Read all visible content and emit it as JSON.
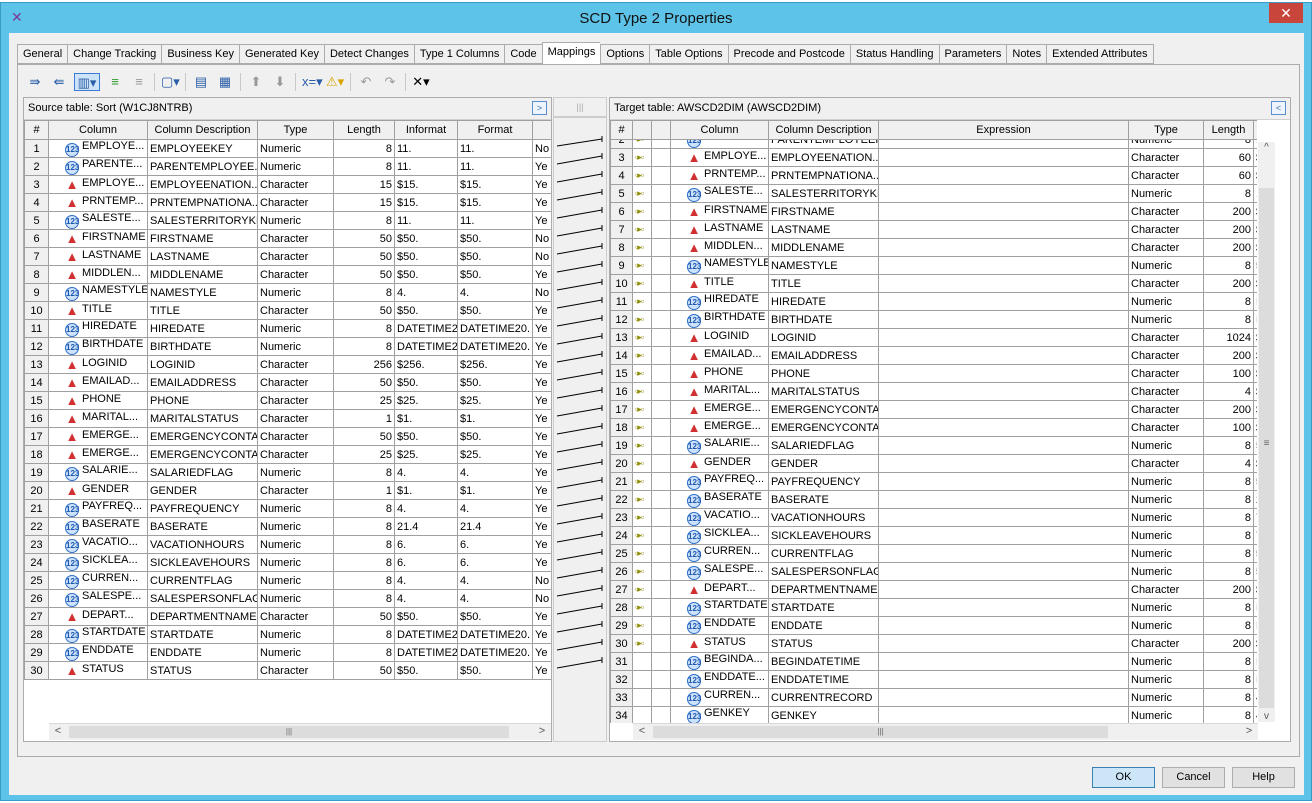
{
  "window": {
    "title": "SCD Type 2 Properties",
    "close_icon": "close-icon",
    "app_icon": "scd-transform-icon"
  },
  "tabs": [
    "General",
    "Change Tracking",
    "Business Key",
    "Generated Key",
    "Detect Changes",
    "Type 1 Columns",
    "Code",
    "Mappings",
    "Options",
    "Table Options",
    "Precode and Postcode",
    "Status Handling",
    "Parameters",
    "Notes",
    "Extended Attributes"
  ],
  "active_tab": "Mappings",
  "toolbar": [
    "map-source-icon",
    "map-target-icon",
    "map-all-dropdown-icon",
    "map-columns-icon",
    "unmap-columns-icon",
    "new-column-dropdown-icon",
    "import-columns-icon",
    "propagate-icon",
    "move-up-icon",
    "move-down-icon",
    "expression-dropdown-icon",
    "warning-dropdown-icon",
    "undo-icon",
    "redo-icon",
    "delete-dropdown-icon"
  ],
  "source": {
    "title": "Source table: Sort (W1CJ8NTRB)",
    "headers": [
      "#",
      "Column",
      "Column Description",
      "Type",
      "Length",
      "Informat",
      "Format",
      ""
    ],
    "rows": [
      [
        "1",
        "EMPLOYE...",
        "EMPLOYEEKEY",
        "Numeric",
        "8",
        "11.",
        "11.",
        "No"
      ],
      [
        "2",
        "PARENTE...",
        "PARENTEMPLOYEE...",
        "Numeric",
        "8",
        "11.",
        "11.",
        "Ye"
      ],
      [
        "3",
        "EMPLOYE...",
        "EMPLOYEENATION...",
        "Character",
        "15",
        "$15.",
        "$15.",
        "Ye"
      ],
      [
        "4",
        "PRNTEMP...",
        "PRNTEMPNATIONA...",
        "Character",
        "15",
        "$15.",
        "$15.",
        "Ye"
      ],
      [
        "5",
        "SALESTE...",
        "SALESTERRITORYKEY",
        "Numeric",
        "8",
        "11.",
        "11.",
        "Ye"
      ],
      [
        "6",
        "FIRSTNAME",
        "FIRSTNAME",
        "Character",
        "50",
        "$50.",
        "$50.",
        "No"
      ],
      [
        "7",
        "LASTNAME",
        "LASTNAME",
        "Character",
        "50",
        "$50.",
        "$50.",
        "No"
      ],
      [
        "8",
        "MIDDLEN...",
        "MIDDLENAME",
        "Character",
        "50",
        "$50.",
        "$50.",
        "Ye"
      ],
      [
        "9",
        "NAMESTYLE",
        "NAMESTYLE",
        "Numeric",
        "8",
        "4.",
        "4.",
        "No"
      ],
      [
        "10",
        "TITLE",
        "TITLE",
        "Character",
        "50",
        "$50.",
        "$50.",
        "Ye"
      ],
      [
        "11",
        "HIREDATE",
        "HIREDATE",
        "Numeric",
        "8",
        "DATETIME20.",
        "DATETIME20.",
        "Ye"
      ],
      [
        "12",
        "BIRTHDATE",
        "BIRTHDATE",
        "Numeric",
        "8",
        "DATETIME20.",
        "DATETIME20.",
        "Ye"
      ],
      [
        "13",
        "LOGINID",
        "LOGINID",
        "Character",
        "256",
        "$256.",
        "$256.",
        "Ye"
      ],
      [
        "14",
        "EMAILAD...",
        "EMAILADDRESS",
        "Character",
        "50",
        "$50.",
        "$50.",
        "Ye"
      ],
      [
        "15",
        "PHONE",
        "PHONE",
        "Character",
        "25",
        "$25.",
        "$25.",
        "Ye"
      ],
      [
        "16",
        "MARITAL...",
        "MARITALSTATUS",
        "Character",
        "1",
        "$1.",
        "$1.",
        "Ye"
      ],
      [
        "17",
        "EMERGE...",
        "EMERGENCYCONTA...",
        "Character",
        "50",
        "$50.",
        "$50.",
        "Ye"
      ],
      [
        "18",
        "EMERGE...",
        "EMERGENCYCONTA...",
        "Character",
        "25",
        "$25.",
        "$25.",
        "Ye"
      ],
      [
        "19",
        "SALARIE...",
        "SALARIEDFLAG",
        "Numeric",
        "8",
        "4.",
        "4.",
        "Ye"
      ],
      [
        "20",
        "GENDER",
        "GENDER",
        "Character",
        "1",
        "$1.",
        "$1.",
        "Ye"
      ],
      [
        "21",
        "PAYFREQ...",
        "PAYFREQUENCY",
        "Numeric",
        "8",
        "4.",
        "4.",
        "Ye"
      ],
      [
        "22",
        "BASERATE",
        "BASERATE",
        "Numeric",
        "8",
        "21.4",
        "21.4",
        "Ye"
      ],
      [
        "23",
        "VACATIO...",
        "VACATIONHOURS",
        "Numeric",
        "8",
        "6.",
        "6.",
        "Ye"
      ],
      [
        "24",
        "SICKLEA...",
        "SICKLEAVEHOURS",
        "Numeric",
        "8",
        "6.",
        "6.",
        "Ye"
      ],
      [
        "25",
        "CURREN...",
        "CURRENTFLAG",
        "Numeric",
        "8",
        "4.",
        "4.",
        "No"
      ],
      [
        "26",
        "SALESPE...",
        "SALESPERSONFLAG",
        "Numeric",
        "8",
        "4.",
        "4.",
        "No"
      ],
      [
        "27",
        "DEPART...",
        "DEPARTMENTNAME",
        "Character",
        "50",
        "$50.",
        "$50.",
        "Ye"
      ],
      [
        "28",
        "STARTDATE",
        "STARTDATE",
        "Numeric",
        "8",
        "DATETIME20.",
        "DATETIME20.",
        "Ye"
      ],
      [
        "29",
        "ENDDATE",
        "ENDDATE",
        "Numeric",
        "8",
        "DATETIME20.",
        "DATETIME20.",
        "Ye"
      ],
      [
        "30",
        "STATUS",
        "STATUS",
        "Character",
        "50",
        "$50.",
        "$50.",
        "Ye"
      ]
    ]
  },
  "target": {
    "title": "Target table: AWSCD2DIM (AWSCD2DIM)",
    "headers": [
      "#",
      "",
      "",
      "Column",
      "Column Description",
      "Expression",
      "Type",
      "Length",
      ""
    ],
    "rows": [
      [
        "2",
        true,
        "PARENTEM...",
        "PARENTEMPLOYEEK...",
        "",
        "Numeric",
        "8",
        "12"
      ],
      [
        "3",
        true,
        "EMPLOYE...",
        "EMPLOYEENATION...",
        "",
        "Character",
        "60",
        "$6"
      ],
      [
        "4",
        true,
        "PRNTEMP...",
        "PRNTEMPNATIONA...",
        "",
        "Character",
        "60",
        "$6"
      ],
      [
        "5",
        true,
        "SALESTE...",
        "SALESTERRITORYKEY",
        "",
        "Numeric",
        "8",
        "12"
      ],
      [
        "6",
        true,
        "FIRSTNAME",
        "FIRSTNAME",
        "",
        "Character",
        "200",
        "$2"
      ],
      [
        "7",
        true,
        "LASTNAME",
        "LASTNAME",
        "",
        "Character",
        "200",
        "$2"
      ],
      [
        "8",
        true,
        "MIDDLEN...",
        "MIDDLENAME",
        "",
        "Character",
        "200",
        "$2"
      ],
      [
        "9",
        true,
        "NAMESTYLE",
        "NAMESTYLE",
        "",
        "Numeric",
        "8",
        "5."
      ],
      [
        "10",
        true,
        "TITLE",
        "TITLE",
        "",
        "Character",
        "200",
        "$2"
      ],
      [
        "11",
        true,
        "HIREDATE",
        "HIREDATE",
        "",
        "Numeric",
        "8",
        "DA"
      ],
      [
        "12",
        true,
        "BIRTHDATE",
        "BIRTHDATE",
        "",
        "Numeric",
        "8",
        "DA"
      ],
      [
        "13",
        true,
        "LOGINID",
        "LOGINID",
        "",
        "Character",
        "1024",
        "$1"
      ],
      [
        "14",
        true,
        "EMAILAD...",
        "EMAILADDRESS",
        "",
        "Character",
        "200",
        "$2"
      ],
      [
        "15",
        true,
        "PHONE",
        "PHONE",
        "",
        "Character",
        "100",
        "$1"
      ],
      [
        "16",
        true,
        "MARITAL...",
        "MARITALSTATUS",
        "",
        "Character",
        "4",
        "$4"
      ],
      [
        "17",
        true,
        "EMERGE...",
        "EMERGENCYCONTA...",
        "",
        "Character",
        "200",
        "$2"
      ],
      [
        "18",
        true,
        "EMERGE...",
        "EMERGENCYCONTA...",
        "",
        "Character",
        "100",
        "$1"
      ],
      [
        "19",
        true,
        "SALARIE...",
        "SALARIEDFLAG",
        "",
        "Numeric",
        "8",
        "5."
      ],
      [
        "20",
        true,
        "GENDER",
        "GENDER",
        "",
        "Character",
        "4",
        "$4"
      ],
      [
        "21",
        true,
        "PAYFREQ...",
        "PAYFREQUENCY",
        "",
        "Numeric",
        "8",
        "5."
      ],
      [
        "22",
        true,
        "BASERATE",
        "BASERATE",
        "",
        "Numeric",
        "8",
        "22"
      ],
      [
        "23",
        true,
        "VACATIO...",
        "VACATIONHOURS",
        "",
        "Numeric",
        "8",
        "7."
      ],
      [
        "24",
        true,
        "SICKLEA...",
        "SICKLEAVEHOURS",
        "",
        "Numeric",
        "8",
        "7."
      ],
      [
        "25",
        true,
        "CURREN...",
        "CURRENTFLAG",
        "",
        "Numeric",
        "8",
        "5."
      ],
      [
        "26",
        true,
        "SALESPE...",
        "SALESPERSONFLAG",
        "",
        "Numeric",
        "8",
        "5."
      ],
      [
        "27",
        true,
        "DEPART...",
        "DEPARTMENTNAME",
        "",
        "Character",
        "200",
        "$2"
      ],
      [
        "28",
        true,
        "STARTDATE",
        "STARTDATE",
        "",
        "Numeric",
        "8",
        "DA"
      ],
      [
        "29",
        true,
        "ENDDATE",
        "ENDDATE",
        "",
        "Numeric",
        "8",
        "DA"
      ],
      [
        "30",
        true,
        "STATUS",
        "STATUS",
        "",
        "Character",
        "200",
        "$2"
      ],
      [
        "31",
        false,
        "BEGINDA...",
        "BEGINDATETIME",
        "",
        "Numeric",
        "8",
        "DA"
      ],
      [
        "32",
        false,
        "ENDDATE...",
        "ENDDATETIME",
        "",
        "Numeric",
        "8",
        "DA"
      ],
      [
        "33",
        false,
        "CURREN...",
        "CURRENTRECORD",
        "",
        "Numeric",
        "8",
        "4."
      ],
      [
        "34",
        false,
        "GENKEY",
        "GENKEY",
        "",
        "Numeric",
        "8",
        "4."
      ]
    ]
  },
  "buttons": {
    "ok": "OK",
    "cancel": "Cancel",
    "help": "Help"
  },
  "colors": {
    "titlebar": "#5ec3e8",
    "numeric_icon": "#2d6fc9",
    "character_icon": "#d23030"
  }
}
